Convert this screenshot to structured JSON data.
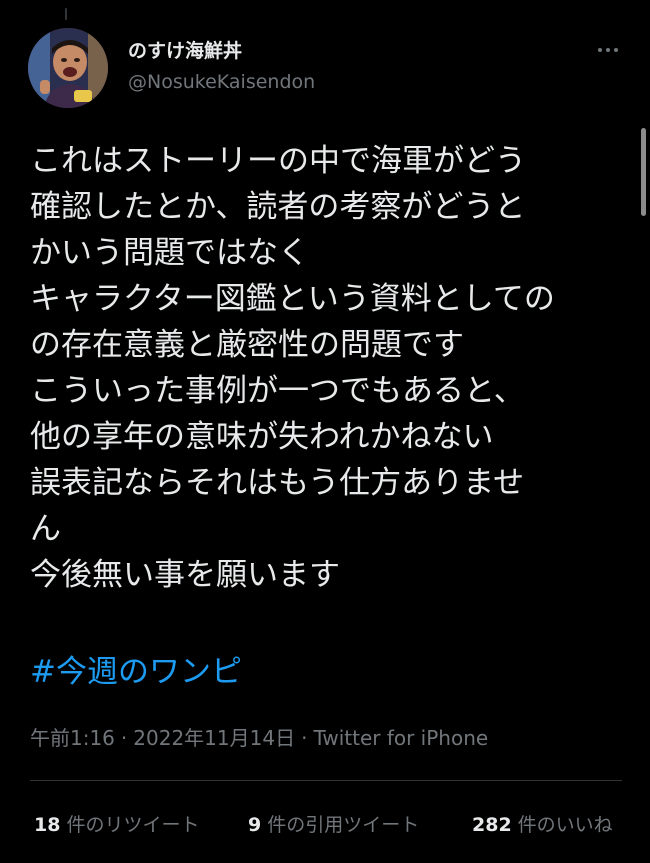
{
  "tweet": {
    "author": {
      "display_name": "のすけ海鮮丼",
      "handle": "@NosukeKaisendon",
      "avatar_icon": "avatar-photo"
    },
    "more_icon": "more-options-icon",
    "lines": [
      "これはストーリーの中で海軍がどう",
      "確認したとか、読者の考察がどうと",
      "かいう問題ではなく",
      "キャラクター図鑑という資料としての",
      "の存在意義と厳密性の問題です",
      "こういった事例が一つでもあると、",
      "他の享年の意味が失われかねない",
      "誤表記ならそれはもう仕方ありませ",
      "ん",
      "今後無い事を願います"
    ],
    "hashtag": "#今週のワンピ",
    "time": "午前1:16",
    "separator": "·",
    "date": "2022年11月14日",
    "source": "Twitter for iPhone",
    "stats": {
      "retweets": {
        "count": "18",
        "label": "件のリツイート"
      },
      "quotes": {
        "count": "9",
        "label": "件の引用ツイート"
      },
      "likes": {
        "count": "282",
        "label": "件のいいね"
      }
    }
  },
  "colors": {
    "background": "#000000",
    "text": "#e7e9ea",
    "secondary": "#71767b",
    "link": "#1d9bf0",
    "divider": "#2f3336"
  }
}
